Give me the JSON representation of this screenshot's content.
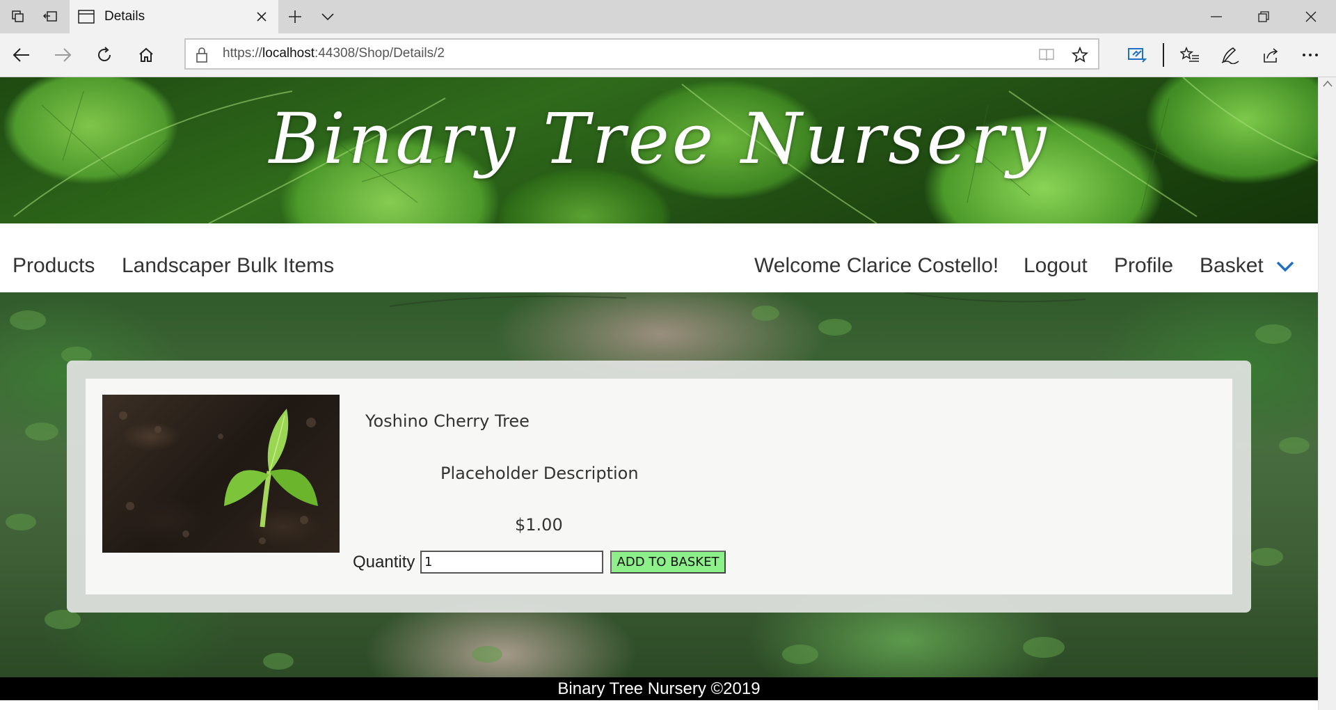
{
  "browser": {
    "tab_title": "Details",
    "url_prefix": "https://",
    "url_host": "localhost",
    "url_path": ":44308/Shop/Details/2"
  },
  "site": {
    "banner_title": "Binary Tree Nursery",
    "nav_left": [
      "Products",
      "Landscaper Bulk Items"
    ],
    "welcome": "Welcome Clarice Costello!",
    "logout": "Logout",
    "profile": "Profile",
    "basket": "Basket"
  },
  "product": {
    "name": "Yoshino Cherry Tree",
    "description": "Placeholder Description",
    "price": "$1.00",
    "quantity_label": "Quantity",
    "quantity_value": "1",
    "add_button": "ADD TO BASKET"
  },
  "footer": {
    "text": "Binary Tree Nursery ©2019"
  },
  "colors": {
    "add_button_bg": "#8ef08a",
    "footer_bg": "#000000",
    "accent_chevron": "#1f6fc4"
  }
}
